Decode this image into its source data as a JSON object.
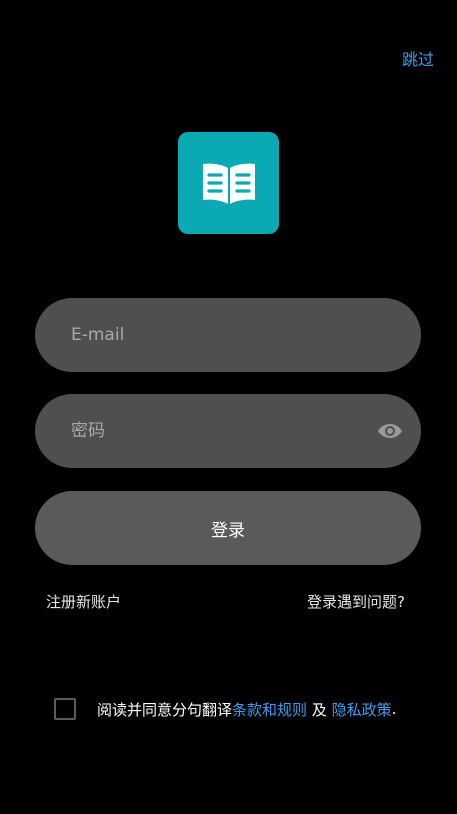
{
  "header": {
    "skip_label": "跳过"
  },
  "logo": {
    "icon": "open-book-icon",
    "color": "#0aa9b3"
  },
  "form": {
    "email_placeholder": "E-mail",
    "password_placeholder": "密码",
    "login_label": "登录"
  },
  "links": {
    "register": "注册新账户",
    "trouble": "登录遇到问题?"
  },
  "agreement": {
    "prefix": "阅读并同意分句翻译",
    "terms": "条款和规则",
    "and": " 及 ",
    "privacy": "隐私政策",
    "suffix": "."
  },
  "colors": {
    "link": "#3c9bf0",
    "background": "#000000"
  }
}
